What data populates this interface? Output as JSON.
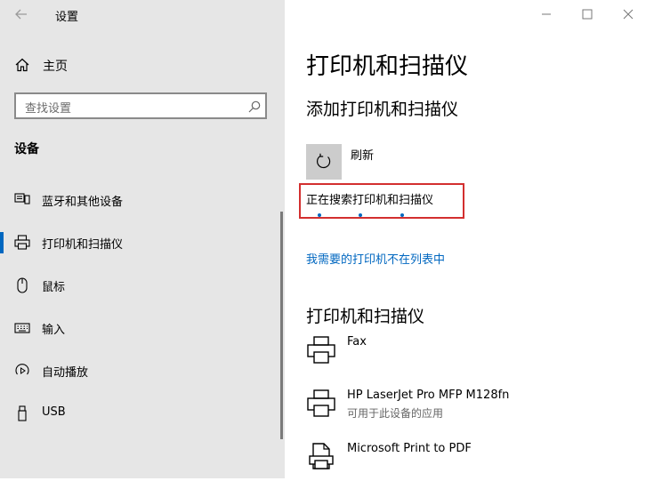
{
  "window": {
    "app_title": "设置"
  },
  "sidebar": {
    "home_label": "主页",
    "search_placeholder": "查找设置",
    "section_title": "设备",
    "items": [
      {
        "label": "蓝牙和其他设备",
        "icon": "bluetooth-devices-icon"
      },
      {
        "label": "打印机和扫描仪",
        "icon": "printer-icon",
        "active": true
      },
      {
        "label": "鼠标",
        "icon": "mouse-icon"
      },
      {
        "label": "输入",
        "icon": "keyboard-icon"
      },
      {
        "label": "自动播放",
        "icon": "autoplay-icon"
      },
      {
        "label": "USB",
        "icon": "usb-icon"
      }
    ]
  },
  "main": {
    "page_title": "打印机和扫描仪",
    "add_section_title": "添加打印机和扫描仪",
    "refresh_label": "刷新",
    "searching_text": "正在搜索打印机和扫描仪",
    "not_listed_link": "我需要的打印机不在列表中",
    "printers_section_title": "打印机和扫描仪",
    "printers": [
      {
        "name": "Fax",
        "status": ""
      },
      {
        "name": "HP LaserJet Pro MFP M128fn",
        "status": "可用于此设备的应用"
      },
      {
        "name": "Microsoft Print to PDF",
        "status": ""
      }
    ]
  },
  "colors": {
    "accent": "#0067c0",
    "sidebar_bg": "#e6e6e6",
    "highlight_border": "#d32f2f"
  }
}
